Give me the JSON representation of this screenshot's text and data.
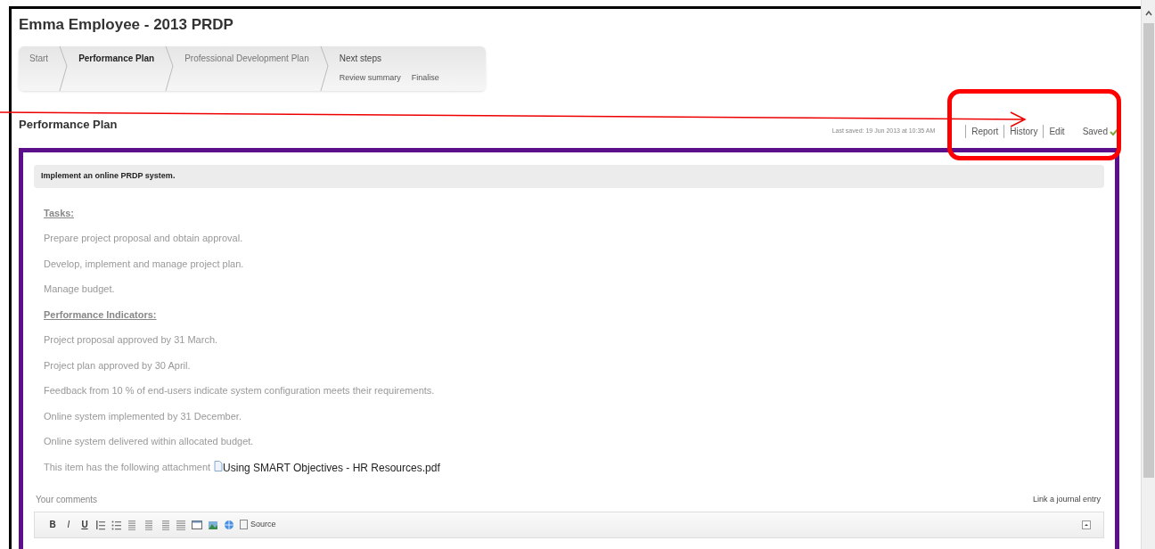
{
  "title": "Emma Employee - 2013 PRDP",
  "steps": [
    {
      "label": "Start",
      "selected": false
    },
    {
      "label": "Performance Plan",
      "selected": true
    },
    {
      "label": "Professional Development Plan",
      "selected": false
    },
    {
      "label": "Next steps",
      "selected": false,
      "substeps": [
        "Review summary",
        "Finalise"
      ]
    }
  ],
  "section": {
    "title": "Performance Plan",
    "last_saved": "Last saved: 19 Jun 2013 at 10:35 AM",
    "links": [
      "Report",
      "History",
      "Edit"
    ],
    "status": "Saved"
  },
  "objective": "Implement an online PRDP system.",
  "body": [
    {
      "kind": "heading",
      "text": "Tasks:"
    },
    {
      "kind": "para",
      "text": "Prepare project proposal and obtain approval."
    },
    {
      "kind": "para",
      "text": "Develop, implement and manage project plan."
    },
    {
      "kind": "para",
      "text": "Manage budget."
    },
    {
      "kind": "heading",
      "text": "Performance Indicators:"
    },
    {
      "kind": "para",
      "text": "Project proposal approved by 31 March."
    },
    {
      "kind": "para",
      "text": "Project plan approved by 30 April."
    },
    {
      "kind": "para",
      "text": "Feedback from 10 % of end-users indicate system configuration meets their requirements."
    },
    {
      "kind": "para",
      "text": "Online system implemented by 31 December."
    },
    {
      "kind": "para",
      "text": "Online system delivered within allocated budget."
    }
  ],
  "attachment": {
    "prefix": "This item has the following attachment",
    "filename": "Using SMART Objectives - HR Resources.pdf"
  },
  "comments": {
    "label": "Your comments",
    "link": "Link a journal entry",
    "letters": [
      "B",
      "I",
      "U"
    ],
    "source": "Source"
  }
}
